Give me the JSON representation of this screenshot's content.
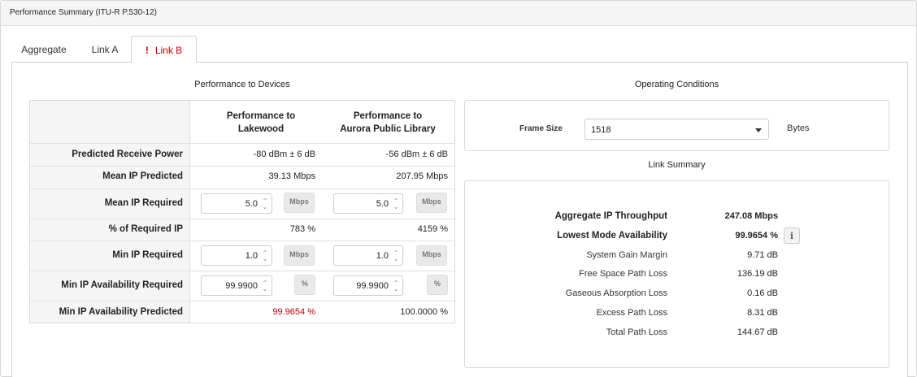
{
  "panel": {
    "title": "Performance Summary (ITU-R P.530-12)"
  },
  "tabs": [
    {
      "label": "Aggregate",
      "active": false
    },
    {
      "label": "Link A",
      "active": false
    },
    {
      "label": "Link B",
      "active": true,
      "warning_icon": "!"
    }
  ],
  "performance": {
    "title": "Performance to Devices",
    "columns": [
      "Performance to\nLakewood",
      "Performance to\nAurora Public Library"
    ],
    "rows": {
      "predicted_receive_power": {
        "label": "Predicted Receive Power",
        "values": [
          "-80 dBm ± 6 dB",
          "-56 dBm ± 6 dB"
        ]
      },
      "mean_ip_predicted": {
        "label": "Mean IP Predicted",
        "values": [
          "39.13 Mbps",
          "207.95 Mbps"
        ]
      },
      "mean_ip_required": {
        "label": "Mean IP Required",
        "values": [
          "5.0",
          "5.0"
        ],
        "unit": "Mbps"
      },
      "pct_required_ip": {
        "label": "% of Required IP",
        "values": [
          "783 %",
          "4159 %"
        ]
      },
      "min_ip_required": {
        "label": "Min IP Required",
        "values": [
          "1.0",
          "1.0"
        ],
        "unit": "Mbps"
      },
      "min_ip_avail_required": {
        "label": "Min IP Availability Required",
        "values": [
          "99.9900",
          "99.9900"
        ],
        "unit": "%"
      },
      "min_ip_avail_predicted": {
        "label": "Min IP Availability Predicted",
        "values": [
          "99.9654 %",
          "100.0000 %"
        ]
      }
    }
  },
  "operating": {
    "title": "Operating Conditions",
    "frame_size_label": "Frame Size",
    "frame_size_value": "1518",
    "frame_size_unit": "Bytes"
  },
  "link_summary": {
    "title": "Link Summary",
    "rows": [
      {
        "label": "Aggregate IP Throughput",
        "value": "247.08 Mbps",
        "bold": true
      },
      {
        "label": "Lowest Mode Availability",
        "value": "99.9654 %",
        "bold": true
      },
      {
        "label": "System Gain Margin",
        "value": "9.71 dB"
      },
      {
        "label": "Free Space Path Loss",
        "value": "136.19 dB"
      },
      {
        "label": "Gaseous Absorption Loss",
        "value": "0.16 dB"
      },
      {
        "label": "Excess Path Loss",
        "value": "8.31 dB"
      },
      {
        "label": "Total Path Loss",
        "value": "144.67 dB"
      }
    ],
    "info_icon": "i"
  },
  "colors": {
    "warning": "#c00000",
    "label_bg": "#f5f5f5",
    "border": "#d9d9d9"
  }
}
